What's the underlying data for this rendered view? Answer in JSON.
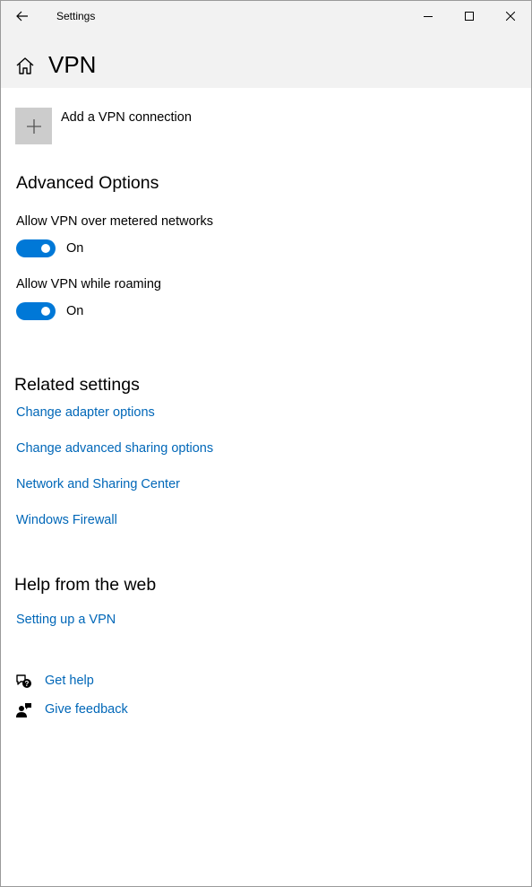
{
  "window": {
    "title": "Settings"
  },
  "header": {
    "page_title": "VPN"
  },
  "add_connection": {
    "label": "Add a VPN connection"
  },
  "advanced": {
    "heading": "Advanced Options",
    "options": [
      {
        "label": "Allow VPN over metered networks",
        "state": "On",
        "enabled": true
      },
      {
        "label": "Allow VPN while roaming",
        "state": "On",
        "enabled": true
      }
    ]
  },
  "related": {
    "heading": "Related settings",
    "links": [
      "Change adapter options",
      "Change advanced sharing options",
      "Network and Sharing Center",
      "Windows Firewall"
    ]
  },
  "help_web": {
    "heading": "Help from the web",
    "links": [
      "Setting up a VPN"
    ]
  },
  "support": {
    "get_help": "Get help",
    "give_feedback": "Give feedback"
  },
  "colors": {
    "accent": "#0078d7",
    "link": "#0067b8",
    "chrome": "#f2f2f2",
    "tile": "#cccccc"
  },
  "icons": {
    "back": "back-arrow-icon",
    "minimize": "minimize-icon",
    "maximize": "maximize-icon",
    "close": "close-icon",
    "home": "home-icon",
    "add": "plus-icon",
    "get_help": "chat-help-icon",
    "give_feedback": "feedback-person-icon"
  }
}
